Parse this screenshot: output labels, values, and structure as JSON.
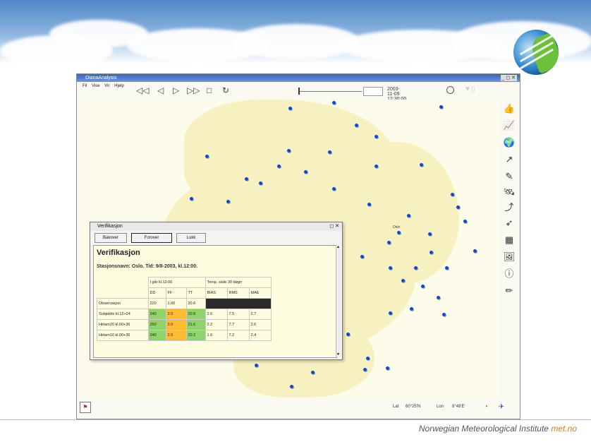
{
  "slide": {
    "footer_text": "Norwegian Meteorological Institute",
    "footer_brand": "met.no"
  },
  "app": {
    "title": "DianaAnalysis",
    "menu": [
      "Fil",
      "Vise",
      "Vir",
      "Hjelp"
    ],
    "datetime": "2003-11-09 12:30:00",
    "status": {
      "lat_label": "Lat",
      "lat_value": "60°25'N",
      "lon_label": "Lon",
      "lon_value": "8°48'E"
    },
    "map_labels": {
      "oslo": "Oslo"
    }
  },
  "dialog": {
    "title": "Verifikasjon",
    "buttons": [
      "Bakover",
      "Forover",
      "Lukk"
    ],
    "heading": "Verifikasjon",
    "station_line": "Stasjonsnavn: Oslo. Tid: 9/8-2003, kl.12:00.",
    "group_headers": [
      "I går kl.12:00",
      "Temp. siste 30 døgn"
    ],
    "columns": [
      "DD",
      "FF",
      "TT",
      "BIAS",
      "RMS",
      "MAE"
    ],
    "rows": [
      {
        "label": "Observasjon",
        "values": [
          "220",
          "1.00",
          "20.6",
          "",
          "",
          ""
        ]
      },
      {
        "label": "Subjektiv kl.12+24",
        "values": [
          "240",
          "2.0",
          "20.8",
          "2.0",
          "7.5",
          "2.7"
        ]
      },
      {
        "label": "Hirlam20 kl.00+36",
        "values": [
          "260",
          "2.0",
          "21.6",
          "2.2",
          "7.7",
          "2.6"
        ]
      },
      {
        "label": "Hirlam10 kl.00+36",
        "values": [
          "240",
          "2.0",
          "20.2",
          "1.6",
          "7.2",
          "2.4"
        ]
      }
    ]
  }
}
